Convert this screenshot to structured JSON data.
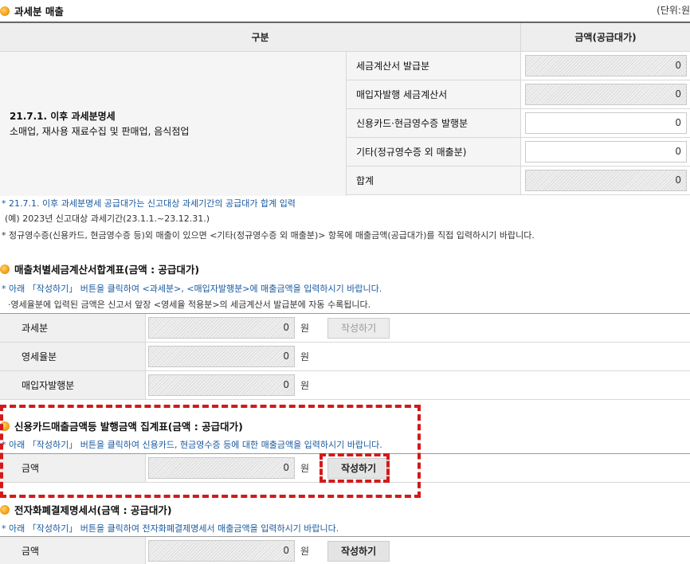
{
  "section1": {
    "title": "과세분 매출",
    "unit": "(단위:원",
    "col_header_category": "구분",
    "col_header_amount": "금액(공급대가)",
    "group_label_line1": "21.7.1. 이후 과세분명세",
    "group_label_line2": "소매업, 재사용 재료수집 및 판매업, 음식점업",
    "rows": [
      {
        "label": "세금계산서 발급분",
        "value": "0"
      },
      {
        "label": "매입자발행 세금계산서",
        "value": "0"
      },
      {
        "label": "신용카드·현금영수증 발행분",
        "value": "0"
      },
      {
        "label": "기타(정규영수증 외 매출분)",
        "value": "0"
      },
      {
        "label": "합계",
        "value": "0"
      }
    ],
    "notes": [
      "* 21.7.1. 이후 과세분명세 공급대가는 신고대상 과세기간의 공급대가 합계 입력",
      "(예) 2023년 신고대상 과세기간(23.1.1.~23.12.31.)",
      "* 정규영수증(신용카드, 현금영수증 등)외 매출이 있으면 <기타(정규영수증 외 매출분)> 항목에 매출금액(공급대가)를 직접 입력하시기 바랍니다."
    ]
  },
  "section2": {
    "title": "매출처별세금계산서합계표(금액 : 공급대가)",
    "notes": [
      "* 아래 「작성하기」 버튼을 클릭하여 <과세분>, <매입자발행분>에 매출금액을 입력하시기 바랍니다.",
      "·영세율분에 입력된 금액은 신고서 앞장 <영세율 적용분>의 세금계산서 발급분에 자동 수록됩니다."
    ],
    "rows": [
      {
        "label": "과세분",
        "value": "0",
        "unit": "원",
        "button": "작성하기"
      },
      {
        "label": "영세율분",
        "value": "0",
        "unit": "원"
      },
      {
        "label": "매입자발행분",
        "value": "0",
        "unit": "원"
      }
    ]
  },
  "section3": {
    "title": "신용카드매출금액등 발행금액 집계표(금액 : 공급대가)",
    "note": "* 아래 「작성하기」 버튼을 클릭하여 신용카드, 현금영수증 등에 대한 매출금액을 입력하시기 바랍니다.",
    "row": {
      "label": "금액",
      "value": "0",
      "unit": "원",
      "button": "작성하기"
    }
  },
  "section4": {
    "title": "전자화폐결제명세서(금액 : 공급대가)",
    "note": "* 아래 「작성하기」 버튼을 클릭하여 전자화폐결제명세서 매출금액을 입력하시기 바랍니다.",
    "row": {
      "label": "금액",
      "value": "0",
      "unit": "원",
      "button": "작성하기"
    }
  },
  "colors": {
    "accent_bullet": "#f3a21b",
    "note_blue": "#1a5aa0",
    "highlight_red": "#d21a1a"
  }
}
